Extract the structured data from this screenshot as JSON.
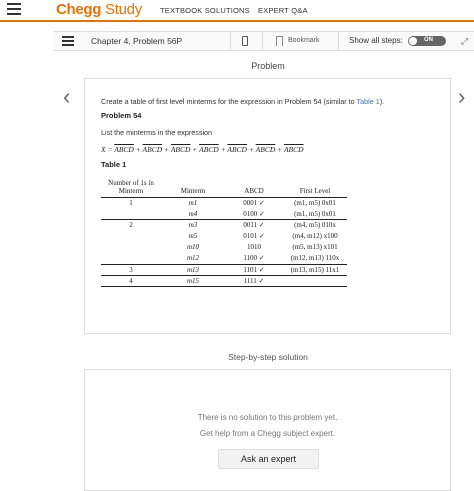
{
  "header": {
    "brand_main": "Chegg",
    "brand_sub": "Study",
    "nav": [
      "TEXTBOOK SOLUTIONS",
      "EXPERT Q&A"
    ]
  },
  "toolbar": {
    "chapter": "Chapter 4, Problem 56P",
    "bookmark": "Bookmark",
    "show_steps": "Show all steps:",
    "toggle": "ON"
  },
  "problem": {
    "heading": "Problem",
    "intro_before": "Create a table of first level minterms for the expression in Problem 54 (similar to ",
    "intro_link": "Table 1",
    "intro_after": ").",
    "sub_title": "Problem 54",
    "list_line": "List the minterms in the expression",
    "expression": "X = ABCD + ABCD + ABCD + ABCD + ABCD + ABCD + ABCD",
    "table_caption": "Table 1"
  },
  "minterm_table": {
    "headers": [
      "Number of 1s in Minterm",
      "Minterm",
      "ABCD",
      "First Level"
    ],
    "rows": [
      [
        "1",
        "m1",
        "0001 ✓",
        "(m1, m5) 0x01"
      ],
      [
        "",
        "m4",
        "0100 ✓",
        "(m1, m5) 0x01"
      ],
      [
        "2",
        "m3",
        "0011 ✓",
        "(m4, m5) 010x"
      ],
      [
        "",
        "m5",
        "0101 ✓",
        "(m4, m12) x100"
      ],
      [
        "",
        "m10",
        "1010",
        "(m5, m13) x101"
      ],
      [
        "",
        "m12",
        "1100 ✓",
        "(m12, m13) 110x"
      ],
      [
        "3",
        "m13",
        "1101 ✓",
        "(m13, m15) 11x1"
      ],
      [
        "4",
        "m15",
        "1111 ✓",
        ""
      ]
    ]
  },
  "solution": {
    "heading": "Step-by-step solution",
    "no_solution": "There is no solution to this problem yet.",
    "get_help": "Get help from a Chegg subject expert.",
    "ask_button": "Ask an expert"
  },
  "colors": {
    "brand": "#eb7100",
    "link": "#3b6fc4"
  }
}
